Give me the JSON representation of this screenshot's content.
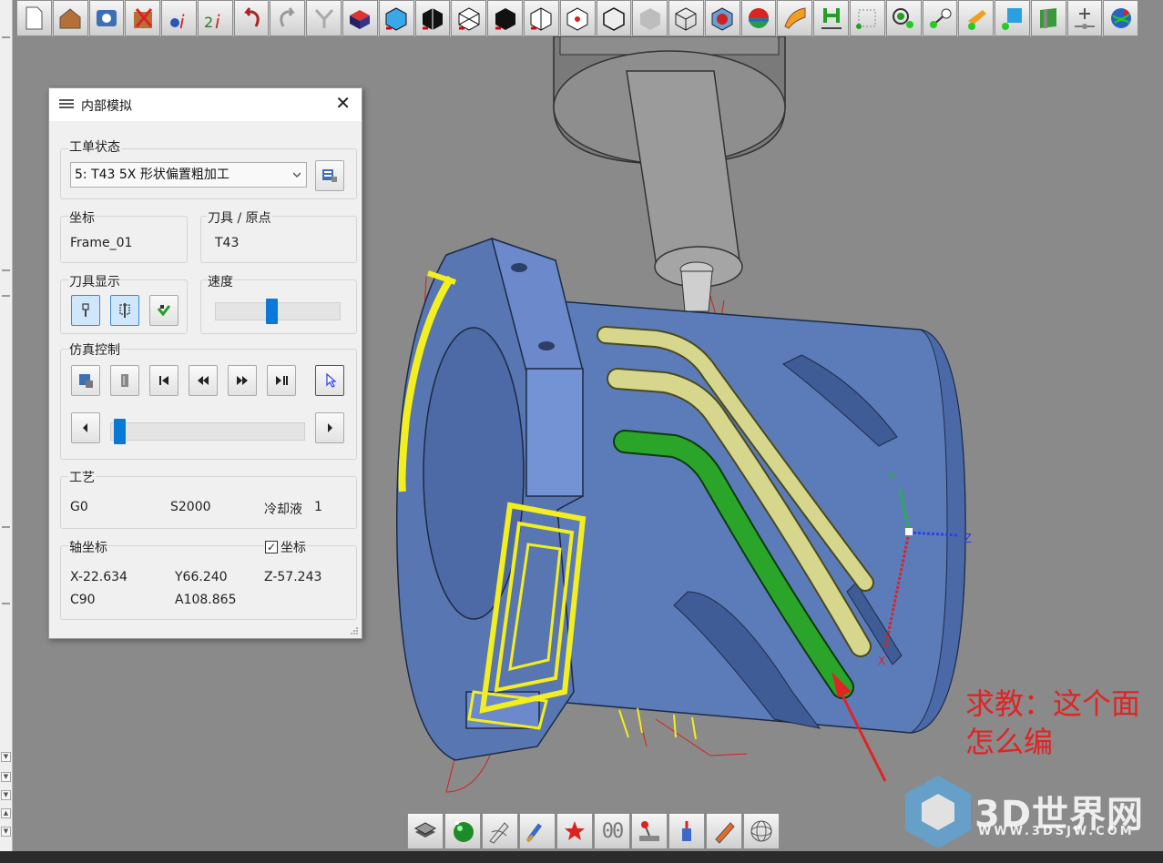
{
  "toolbar": {
    "top_icons": [
      "new-file-icon",
      "open-house-icon",
      "open-folder-icon",
      "delete-icon",
      "info-icon",
      "info2-icon",
      "undo-icon",
      "redo-icon",
      "reset-view-icon",
      "cube-top-icon",
      "cube-wire-icon",
      "cube-left-icon",
      "cube-iso-wire-icon",
      "cube-front-icon",
      "cube-right-wire-icon",
      "cube-vertex-icon",
      "cube-solid-icon",
      "cube-grey-icon",
      "cube-wireframe-icon",
      "cube-red-core-icon",
      "sphere-color-icon",
      "surface-orange-icon",
      "tool-green-icon",
      "measure-icon",
      "node-green-icon",
      "connect-green-icon",
      "probe-icon",
      "blue-cube-icon",
      "green-surface-icon",
      "add-point-icon",
      "globe-icon"
    ],
    "bottom_icons": [
      "layers-icon",
      "green-ball-icon",
      "pencil-sketch-icon",
      "brush-icon",
      "star-icon",
      "counter-icon",
      "joystick-icon",
      "spray-icon",
      "pen-icon",
      "wire-sphere-icon"
    ],
    "counter_label": "00"
  },
  "dialog": {
    "title": "内部模拟",
    "order_status": {
      "label": "工单状态",
      "selected": "5: T43 5X 形状偏置粗加工"
    },
    "coordinate": {
      "label": "坐标",
      "value": "Frame_01"
    },
    "tool_origin": {
      "label": "刀具 / 原点",
      "value": "T43"
    },
    "tool_display": {
      "label": "刀具显示"
    },
    "speed": {
      "label": "速度",
      "level": 0.45
    },
    "sim_control": {
      "label": "仿真控制",
      "progress": 0.02
    },
    "process": {
      "label": "工艺",
      "g_code": "G0",
      "spindle": "S2000",
      "coolant_label": "冷却液",
      "coolant_value": "1"
    },
    "axis_coords": {
      "label": "轴坐标",
      "checkbox_label": "坐标",
      "checked": true,
      "x": "X-22.634",
      "y": "Y66.240",
      "z": "Z-57.243",
      "c": "C90",
      "a": "A108.865"
    }
  },
  "viewport": {
    "axis_labels": {
      "x": "X",
      "y": "Y",
      "z": "Z"
    }
  },
  "annotation": {
    "line1": "求教：这个面",
    "line2": "怎么编"
  },
  "watermark": {
    "brand": "3D世界网",
    "url": "WWW.3DSJW.COM"
  }
}
